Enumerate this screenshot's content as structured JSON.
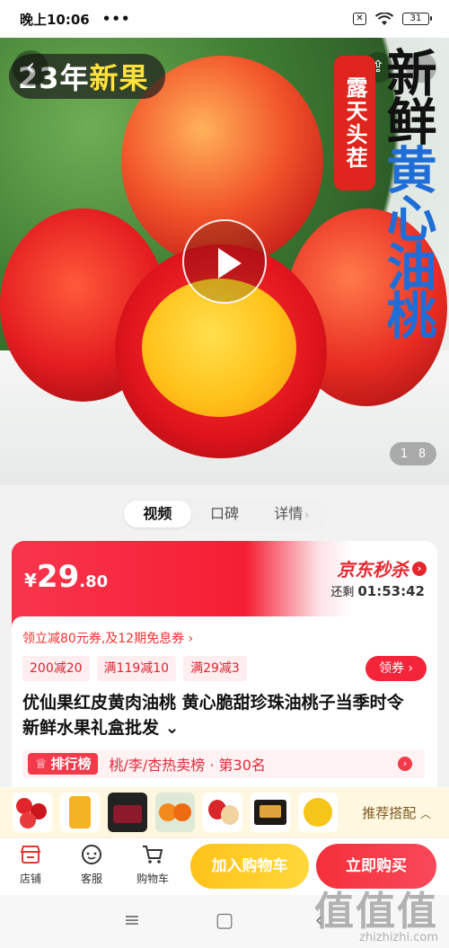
{
  "status_bar": {
    "time": "晚上10:06",
    "dots": "•••",
    "battery": "31",
    "x_icon": "✕"
  },
  "hero": {
    "badge_year": "23年",
    "badge_new": "新果",
    "side_tag": "露天头茬",
    "title_line1": "新鲜",
    "title_line2": "黄心油桃",
    "page_current": "1",
    "page_total": "8"
  },
  "tabs": [
    {
      "label": "视频"
    },
    {
      "label": "口碑"
    },
    {
      "label": "详情"
    }
  ],
  "price": {
    "currency": "¥",
    "integer": "29",
    "decimal": ".80"
  },
  "flash_sale": {
    "label": "京东秒杀",
    "remain_label": "还剩",
    "remain_time": "01:53:42"
  },
  "promo": {
    "text": "领立减80元券,及12期免息券",
    "chevron": "›"
  },
  "coupons": [
    {
      "label": "200减20"
    },
    {
      "label": "满119减10"
    },
    {
      "label": "满29减3"
    }
  ],
  "get_coupon": "领券",
  "product_title": "优仙果红皮黄肉油桃 黄心脆甜珍珠油桃子当季时令新鲜水果礼盒批发",
  "rank": {
    "badge": "排行榜",
    "text": "桃/李/杏热卖榜 · 第30名"
  },
  "recommend": {
    "label": "推荐搭配"
  },
  "bottom_bar": {
    "store": "店铺",
    "service": "客服",
    "cart": "购物车",
    "add_to_cart": "加入购物车",
    "buy_now": "立即购买"
  },
  "watermark": {
    "big": "值值值",
    "small": "zhizhizhi.com"
  },
  "colors": {
    "accent_red": "#f51e33",
    "accent_yellow": "#ffc21a",
    "blue_title": "#1f6ed8"
  }
}
